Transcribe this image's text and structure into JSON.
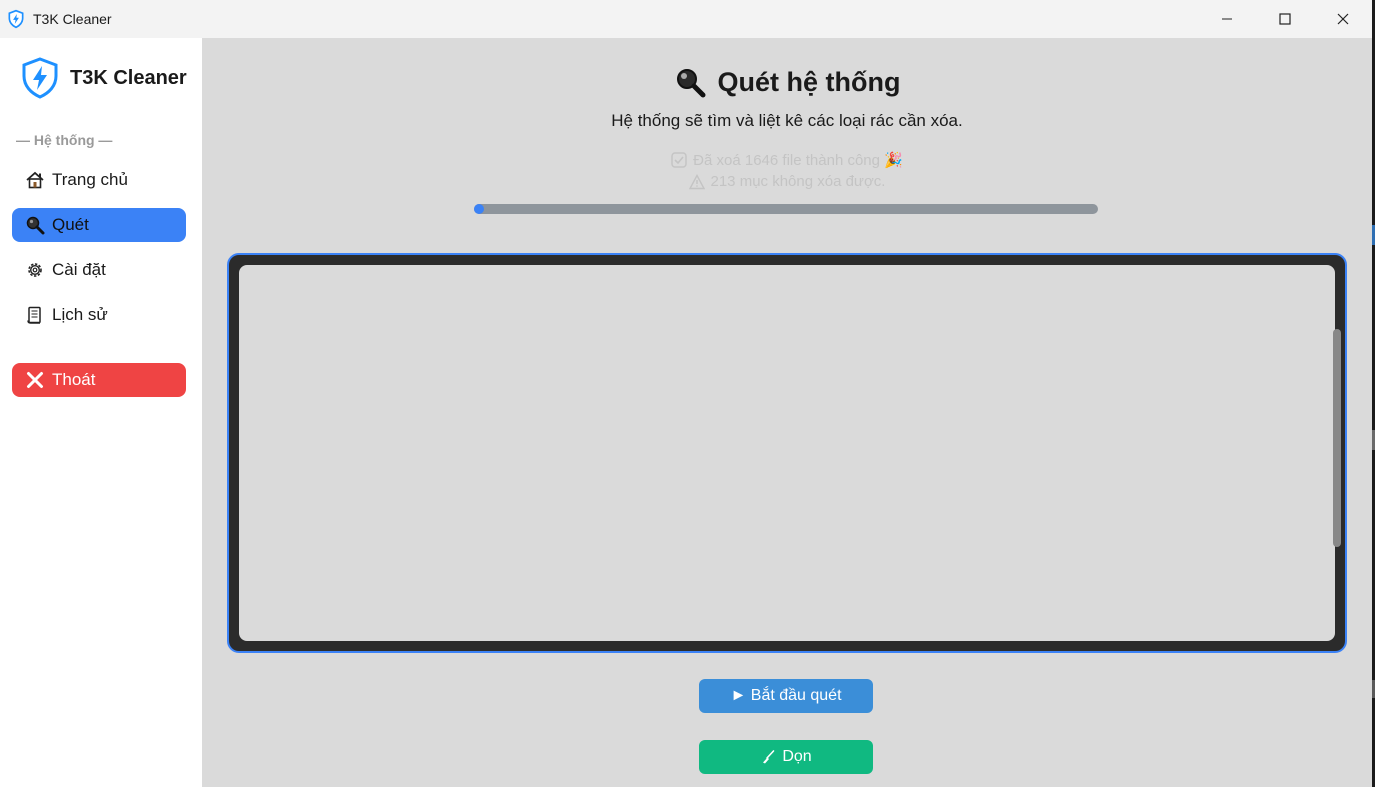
{
  "window": {
    "title": "T3K Cleaner",
    "controls": [
      "minimize",
      "maximize",
      "close"
    ]
  },
  "sidebar": {
    "brand": "T3K Cleaner",
    "section_title": "— Hệ thống —",
    "items": [
      {
        "label": "Trang chủ",
        "icon": "home-icon"
      },
      {
        "label": "Quét",
        "icon": "magnifier-icon",
        "active": true
      },
      {
        "label": "Cài đặt",
        "icon": "gear-icon"
      },
      {
        "label": "Lịch sử",
        "icon": "scroll-icon"
      }
    ],
    "exit_label": "Thoát"
  },
  "main": {
    "title": "Quét hệ thống",
    "subtitle": "Hệ thống sẽ tìm và liệt kê các loại rác cần xóa.",
    "status_deleted": "Đã xoá 1646 file thành công 🎉",
    "status_failed": "213 mục không xóa được.",
    "progress": 0.01,
    "scan_button": "► Bắt đầu quét",
    "clean_button": "Dọn"
  },
  "colors": {
    "accent": "#3b82f6",
    "danger": "#ef4444",
    "success": "#10b981",
    "scan_button": "#3b8ed8"
  }
}
